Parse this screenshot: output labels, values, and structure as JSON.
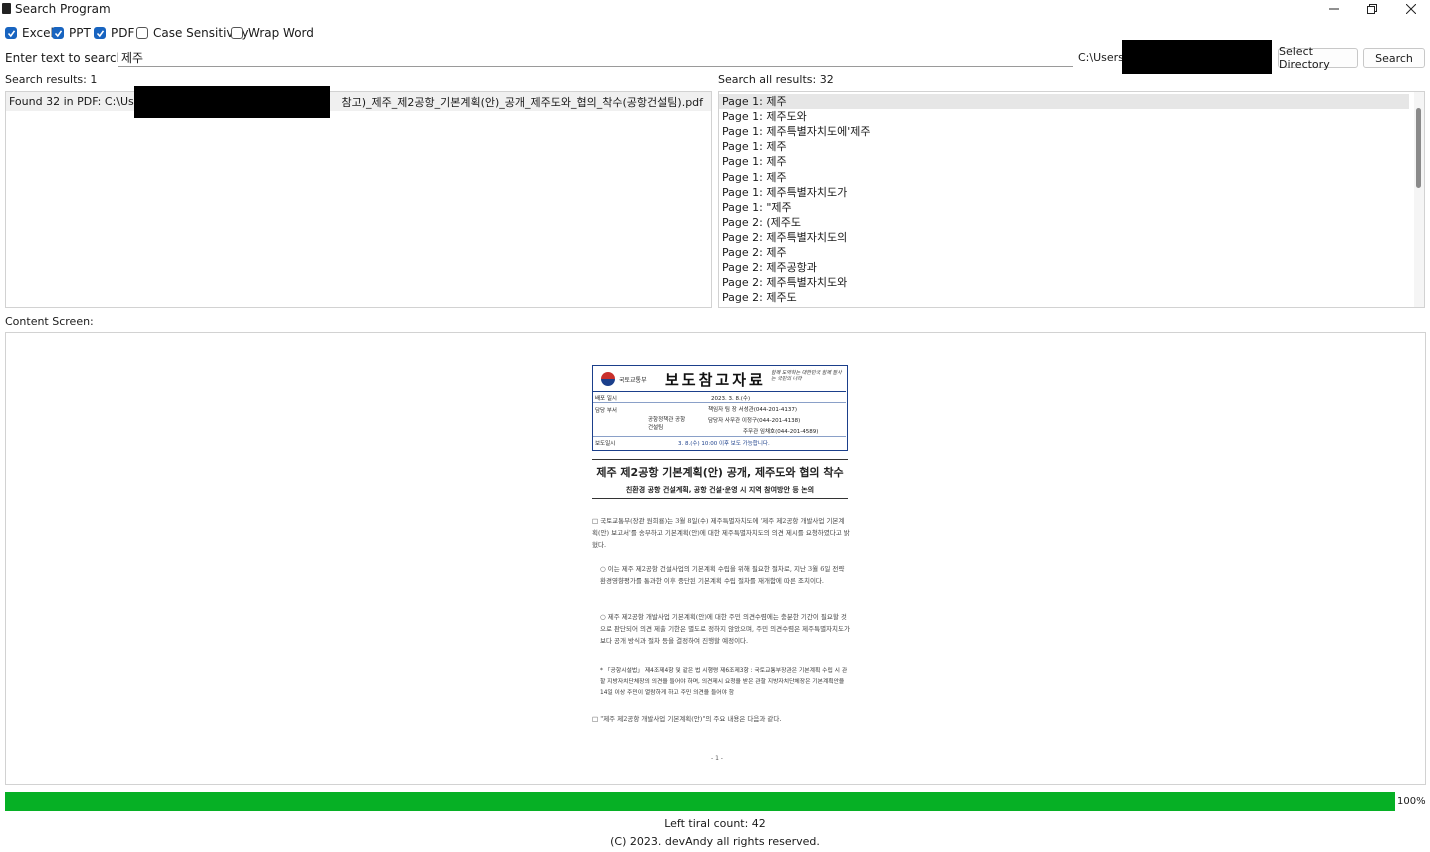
{
  "window": {
    "title": "Search Program"
  },
  "filters": [
    {
      "label": "Excel",
      "checked": true
    },
    {
      "label": "PPT",
      "checked": true
    },
    {
      "label": "PDF",
      "checked": true
    },
    {
      "label": "Case Sensitivity",
      "checked": false
    },
    {
      "label": "Wrap Word",
      "checked": false
    }
  ],
  "search": {
    "label": "Enter text to search for:",
    "value": "제주",
    "directory": "C:\\Users\\",
    "select_directory_label": "Select Directory",
    "search_label": "Search"
  },
  "results": {
    "label": "Search results: 1",
    "items": [
      {
        "prefix": "Found 32 in PDF: C:\\Users\\",
        "suffix": "참고)_제주_제2공항_기본계획(안)_공개_제주도와_협의_착수(공항건설팀).pdf"
      }
    ]
  },
  "all_results": {
    "label": "Search all results: 32",
    "items": [
      "Page 1: 제주",
      "Page 1: 제주도와",
      "Page 1: 제주특별자치도에'제주",
      "Page 1: 제주",
      "Page 1: 제주",
      "Page 1: 제주",
      "Page 1: 제주특별자치도가",
      "Page 1: \"제주",
      "Page 2: (제주도",
      "Page 2: 제주특별자치도의",
      "Page 2: 제주",
      "Page 2: 제주공항과",
      "Page 2: 제주특별자치도와",
      "Page 2: 제주도"
    ]
  },
  "content": {
    "label": "Content Screen:",
    "document": {
      "ministry": "국토교통부",
      "press_title": "보도참고자료",
      "slogan": "함께 도약하는 대한민국 함께 잘사는 국민의 나라",
      "rows": [
        {
          "k": "배포 일시",
          "v": "2023. 3. 8.(수)"
        },
        {
          "k": "담당 부서",
          "v": "공항정책관 공항건설팀"
        },
        {
          "k": "보도일시",
          "v": "3. 8.(수) 10:00 이후 보도 가능합니다."
        }
      ],
      "contacts": [
        "책임자  팀 장  서성관(044-201-4137)",
        "담당자  사무관  이정구(044-201-4138)",
        "주무관  임채호(044-201-4589)"
      ],
      "title": "제주 제2공항 기본계획(안) 공개, 제주도와 협의 착수",
      "subtitle": "친환경 공항 건설계획, 공항 건설·운영 시 지역 참여방안 등 논의",
      "para1": "□ 국토교통부(장관 원희룡)는 3월 8일(수) 제주특별자치도에 '제주 제2공항 개발사업 기본계획(안) 보고서'를 송부하고 기본계획(안)에 대한 제주특별자치도의 의견 제시를 요청하였다고 밝혔다.",
      "para2": "○ 이는 제주 제2공항 건설사업의 기본계획 수립을 위해 필요한 절차로, 지난 3월 6일 전략환경영향평가를 통과한 이후 중단된 기본계획 수립 절차를 재개함에 따른 조치이다.",
      "para3": "○ 제주 제2공항 개발사업 기본계획(안)에 대한 주민 의견수렴에는 충분한 기간이 필요할 것으로 판단되어 의견 제출 기한은 별도로 정하지 않았으며, 주민 의견수렴은 제주특별자치도가 보다 공개 방식과 절차 등을 결정하여 진행할 예정이다.",
      "footnote": "* 「공항시설법」 제4조제4항 및 같은 법 시행령 제6조제3항 : 국토교통부장관은 기본계획 수립 시 관할 지방자치단체장의 의견을 들어야 하며, 의견제시 요청을 받은 관할 지방자치단체장은 기본계획안을 14일 이상 주민이 열람하게 하고 주민 의견을 들어야 함",
      "para4": "□ \"제주 제2공항 개발사업 기본계획(안)\"의 주요 내용은 다음과 같다.",
      "page": "- 1 -"
    }
  },
  "progress": {
    "value": 100,
    "label": "100%",
    "color": "#06b025"
  },
  "footer": {
    "trial": "Left tiral count: 42",
    "copyright": "(C) 2023. devAndy all rights reserved."
  }
}
